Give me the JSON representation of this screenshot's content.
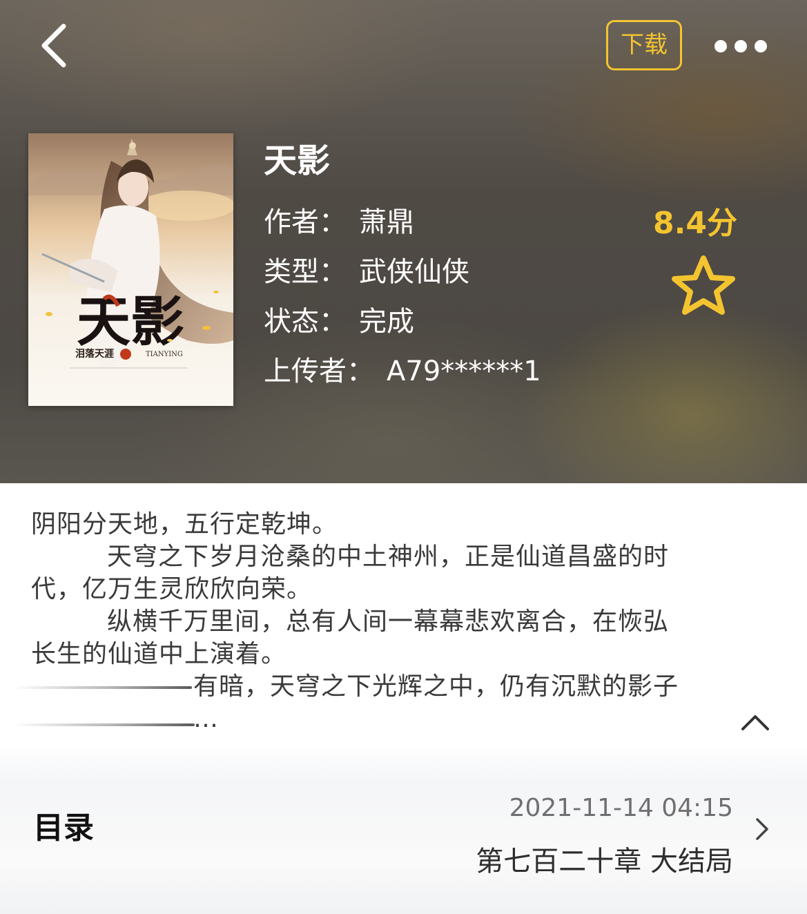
{
  "header": {
    "download_label": "下载",
    "back_icon": "chevron-left-icon",
    "more_icon": "more-horizontal-icon"
  },
  "cover": {
    "title_text": "天影",
    "author_text": "泪落天涯",
    "pinyin_text": "TIANYING"
  },
  "book": {
    "title": "天影",
    "author_label": "作者：",
    "author": "萧鼎",
    "type_label": "类型：",
    "type": "武侠仙侠",
    "status_label": "状态：",
    "status": "完成",
    "uploader_label": "上传者：",
    "uploader": "A79******1"
  },
  "rating": {
    "score": "8.4分",
    "star_icon": "star-outline-icon"
  },
  "synopsis": {
    "line1": "阴阳分天地，五行定乾坤。",
    "line2": "天穹之下岁月沧桑的中土神州，正是仙道昌盛的时",
    "line3": "代，亿万生灵欣欣向荣。",
    "line4": "纵横千万里间，总有人间一幕幕悲欢离合，在恢弘",
    "line5": "长生的仙道中上演着。",
    "line6": "有暗，天穹之下光辉之中，仍有沉默的影子",
    "line7": "…",
    "collapse_icon": "chevron-up-icon"
  },
  "toc": {
    "label": "目录",
    "updated": "2021-11-14 04:15",
    "latest_chapter": "第七百二十章 大结局",
    "chevron_icon": "chevron-right-icon"
  },
  "colors": {
    "accent": "#f4c430",
    "hero_bg": "#55504a",
    "text_dark": "#3a3a3a"
  }
}
